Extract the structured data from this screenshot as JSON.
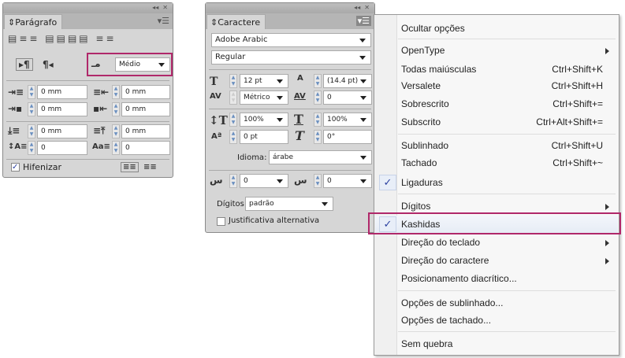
{
  "paragraph": {
    "title": "Parágrafo",
    "kashida_value": "Médio",
    "fields": {
      "left_indent": "0 mm",
      "right_indent": "0 mm",
      "first_line": "0 mm",
      "last_line": "0 mm",
      "space_before": "0 mm",
      "space_after": "0 mm",
      "drop_lines": "0",
      "drop_chars": "0"
    },
    "hyphenate_label": "Hifenizar"
  },
  "character": {
    "title": "Caractere",
    "font": "Adobe Arabic",
    "style": "Regular",
    "size": "12 pt",
    "leading": "(14.4 pt)",
    "kerning": "Métrico",
    "tracking": "0",
    "vscale": "100%",
    "hscale": "100%",
    "baseline": "0 pt",
    "skew": "0°",
    "language_label": "Idioma:",
    "language": "árabe",
    "diacritic_x": "0",
    "diacritic_y": "0",
    "digits_label": "Dígitos:",
    "digits": "padrão",
    "alt_just_label": "Justificativa alternativa"
  },
  "menu": {
    "items": [
      {
        "label": "Ocultar opções",
        "shortcut": ""
      },
      {
        "label": "OpenType",
        "shortcut": ""
      },
      {
        "label": "Todas maiúsculas",
        "shortcut": "Ctrl+Shift+K"
      },
      {
        "label": "Versalete",
        "shortcut": "Ctrl+Shift+H"
      },
      {
        "label": "Sobrescrito",
        "shortcut": "Ctrl+Shift+="
      },
      {
        "label": "Subscrito",
        "shortcut": "Ctrl+Alt+Shift+="
      },
      {
        "label": "Sublinhado",
        "shortcut": "Ctrl+Shift+U"
      },
      {
        "label": "Tachado",
        "shortcut": "Ctrl+Shift+~"
      },
      {
        "label": "Ligaduras",
        "shortcut": ""
      },
      {
        "label": "Dígitos",
        "shortcut": ""
      },
      {
        "label": "Kashidas",
        "shortcut": ""
      },
      {
        "label": "Direção do teclado",
        "shortcut": ""
      },
      {
        "label": "Direção do caractere",
        "shortcut": ""
      },
      {
        "label": "Posicionamento diacrítico...",
        "shortcut": ""
      },
      {
        "label": "Opções de sublinhado...",
        "shortcut": ""
      },
      {
        "label": "Opções de tachado...",
        "shortcut": ""
      },
      {
        "label": "Sem quebra",
        "shortcut": ""
      }
    ],
    "check": "✓"
  },
  "colors": {
    "highlight": "#b0286a"
  }
}
